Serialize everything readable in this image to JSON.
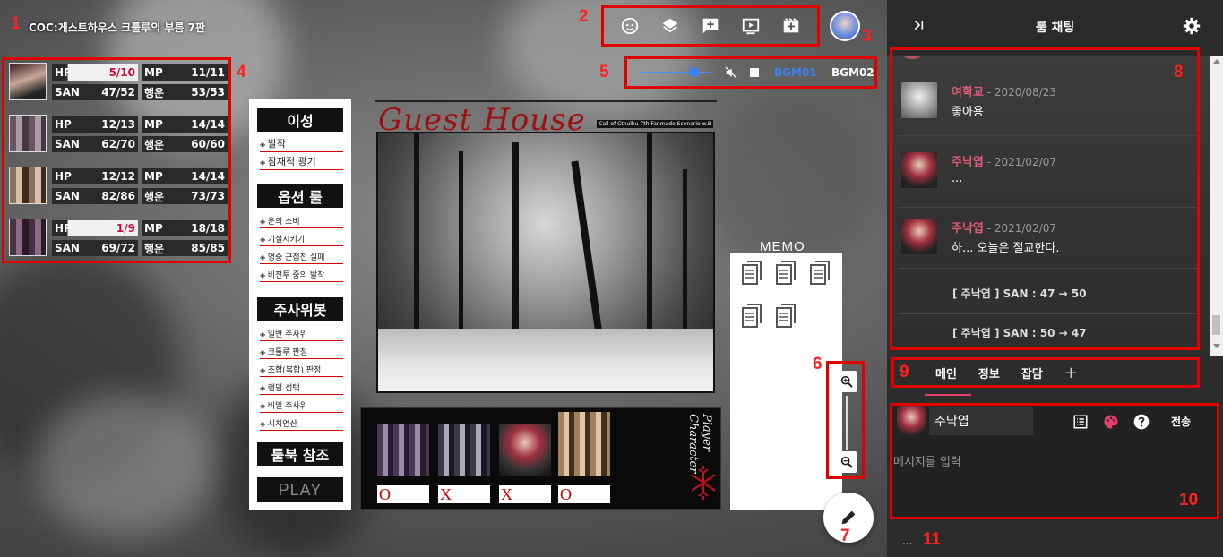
{
  "room_title": "COC:게스트하우스 크툴루의 부름 7판",
  "annotations": [
    "1",
    "2",
    "3",
    "4",
    "5",
    "6",
    "7",
    "8",
    "9",
    "10",
    "11"
  ],
  "toolbar": {
    "icons": [
      "face-icon",
      "layers-icon",
      "add-comment-icon",
      "play-video-icon",
      "add-movie-icon"
    ]
  },
  "bgm": {
    "volume": 0.75,
    "tracks": [
      "BGM01",
      "BGM02"
    ],
    "track_colors": [
      "#3a82f0",
      "#ffffff"
    ]
  },
  "stats": [
    {
      "hp_label": "HP",
      "hp": "5/10",
      "mp_label": "MP",
      "mp": "11/11",
      "san_label": "SAN",
      "san": "47/52",
      "luck_label": "행운",
      "luck": "53/53"
    },
    {
      "hp_label": "HP",
      "hp": "12/13",
      "mp_label": "MP",
      "mp": "14/14",
      "san_label": "SAN",
      "san": "62/70",
      "luck_label": "행운",
      "luck": "60/60"
    },
    {
      "hp_label": "HP",
      "hp": "12/12",
      "mp_label": "MP",
      "mp": "14/14",
      "san_label": "SAN",
      "san": "82/86",
      "luck_label": "행운",
      "luck": "73/73"
    },
    {
      "hp_label": "HP",
      "hp": "1/9",
      "mp_label": "MP",
      "mp": "18/18",
      "san_label": "SAN",
      "san": "69/72",
      "luck_label": "행운",
      "luck": "85/85"
    }
  ],
  "menu": {
    "section1": {
      "heading": "이성",
      "items": [
        "발작",
        "잠재적 광기"
      ]
    },
    "section2": {
      "heading": "옵션 룰",
      "items": [
        "운의 소비",
        "기절시키기",
        "명중 근접전 실패",
        "비전투 중의 발작"
      ]
    },
    "section3": {
      "heading": "주사위봇",
      "items": [
        "일반 주사위",
        "크툴루 판정",
        "조합(복합) 판정",
        "랜덤 선택",
        "비밀 주사위",
        "시치연산"
      ]
    },
    "rulebook": "룰북 참조",
    "play": "PLAY"
  },
  "scene": {
    "title": "Guest House",
    "subtitle": "Call of Cthulhu 7th Fanmade Scenario w.B"
  },
  "pc_strip": {
    "side_label": "Player Character",
    "marks": [
      "O",
      "X",
      "X",
      "O"
    ]
  },
  "memo": {
    "title": "MEMO",
    "count": 5
  },
  "chat": {
    "header_title": "룸 채팅",
    "messages": [
      {
        "name": "여학교",
        "date": " - 2020/08/23",
        "text": "좋아용",
        "name_color": "#e05a7a"
      },
      {
        "name": "주낙엽",
        "date": " - 2021/02/07",
        "text": "...",
        "name_color": "#e05a7a"
      },
      {
        "name": "주낙엽",
        "date": " - 2021/02/07",
        "text": "하... 오늘은 절교한다.",
        "name_color": "#e05a7a"
      }
    ],
    "system_messages": [
      "[ 주낙엽 ] SAN : 47 → 50",
      "[ 주낙엽 ] SAN : 50 → 47"
    ],
    "tabs": [
      "메인",
      "정보",
      "잡담",
      "+"
    ],
    "composer": {
      "name": "주낙엽",
      "send_label": "전송",
      "placeholder": "메시지를 입력"
    },
    "status": "..."
  }
}
